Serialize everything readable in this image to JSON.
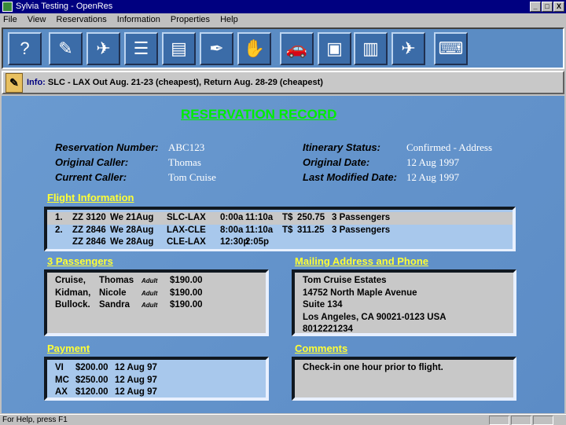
{
  "window": {
    "title": "Sylvia Testing - OpenRes",
    "minimize": "_",
    "maximize": "□",
    "close": "X"
  },
  "menu": [
    "File",
    "View",
    "Reservations",
    "Information",
    "Properties",
    "Help"
  ],
  "toolbar": [
    {
      "icon": "help-icon",
      "glyph": "?"
    },
    {
      "icon": "notepad-icon",
      "glyph": "✎"
    },
    {
      "icon": "globe-plane-icon",
      "glyph": "✈"
    },
    {
      "icon": "documents-icon",
      "glyph": "☰"
    },
    {
      "icon": "file-drawer-icon",
      "glyph": "▤"
    },
    {
      "icon": "scroll-quill-icon",
      "glyph": "✒"
    },
    {
      "icon": "handshake-icon",
      "glyph": "✋"
    },
    {
      "icon": "car-keys-icon",
      "glyph": "🚗"
    },
    {
      "icon": "hotel-lamp-icon",
      "glyph": "▣"
    },
    {
      "icon": "filing-cabinet-icon",
      "glyph": "▥"
    },
    {
      "icon": "runway-icon",
      "glyph": "✈"
    },
    {
      "icon": "computer-key-icon",
      "glyph": "⌨"
    }
  ],
  "info": {
    "label": "Info:",
    "text": "SLC - LAX  Out Aug. 21-23  (cheapest),   Return Aug. 28-29  (cheapest)"
  },
  "record": {
    "title": "RESERVATION RECORD",
    "left": [
      {
        "k": "Reservation Number:",
        "v": "ABC123"
      },
      {
        "k": "Original Caller:",
        "v": "Thomas"
      },
      {
        "k": "Current Caller:",
        "v": "Tom Cruise"
      }
    ],
    "right": [
      {
        "k": "Itinerary Status:",
        "v": "Confirmed - Address"
      },
      {
        "k": "Original Date:",
        "v": "12 Aug 1997"
      },
      {
        "k": "Last Modified Date:",
        "v": "12 Aug 1997"
      }
    ]
  },
  "flights": {
    "heading": "Flight Information",
    "rows": [
      [
        "1.",
        "ZZ 3120",
        "We 21Aug",
        "SLC-LAX",
        "0:00a",
        "11:10a",
        "T$",
        "250.75",
        "3 Passengers"
      ],
      [
        "2.",
        "ZZ 2846",
        "We 28Aug",
        "LAX-CLE",
        "8:00a",
        "11:10a",
        "T$",
        "311.25",
        "3 Passengers"
      ],
      [
        "",
        "ZZ 2846",
        "We 28Aug",
        "CLE-LAX",
        "12:30p",
        "2:05p",
        "",
        "",
        ""
      ]
    ]
  },
  "passengers": {
    "heading": "3 Passengers",
    "rows": [
      [
        "Cruise,",
        "Thomas",
        "Adult",
        "$190.00"
      ],
      [
        "Kidman,",
        "Nicole",
        "Adult",
        "$190.00"
      ],
      [
        "Bullock.",
        "Sandra",
        "Adult",
        "$190.00"
      ]
    ]
  },
  "mailing": {
    "heading": "Mailing Address and Phone",
    "lines": [
      "Tom Cruise Estates",
      "14752 North Maple Avenue",
      "Suite 134",
      "Los Angeles, CA 90021-0123 USA",
      "8012221234"
    ]
  },
  "payment": {
    "heading": "Payment",
    "rows": [
      [
        "VI",
        "$200.00",
        "12 Aug 97"
      ],
      [
        "MC",
        "$250.00",
        "12 Aug 97"
      ],
      [
        "AX",
        "$120.00",
        "12 Aug 97"
      ]
    ]
  },
  "comments": {
    "heading": "Comments",
    "text": "Check-in one hour prior to flight."
  },
  "status": {
    "text": "For Help, press F1"
  }
}
